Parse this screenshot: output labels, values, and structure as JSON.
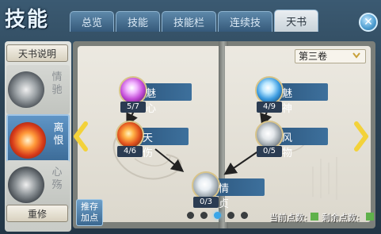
{
  "title": "技能",
  "tabs": [
    {
      "label": "总览"
    },
    {
      "label": "技能"
    },
    {
      "label": "技能栏"
    },
    {
      "label": "连续技"
    },
    {
      "label": "天书"
    }
  ],
  "active_tab": "天书",
  "left_panel": {
    "explain_button": "天书说明",
    "books": [
      {
        "label": "情驰",
        "state": "inactive"
      },
      {
        "label": "离恨",
        "state": "active"
      },
      {
        "label": "心殇",
        "state": "inactive"
      }
    ],
    "reset_button": "重修"
  },
  "recommend_button": "推存加点",
  "volume_selector": {
    "value": "第三卷"
  },
  "skills": [
    {
      "name": "魅心",
      "count": "5/7",
      "icon": "magic-heart-icon"
    },
    {
      "name": "天伤",
      "count": "4/6",
      "icon": "fire-wound-icon"
    },
    {
      "name": "情贞",
      "count": "0/3",
      "icon": "feather-icon"
    },
    {
      "name": "魅神",
      "count": "4/9",
      "icon": "water-spirit-icon"
    },
    {
      "name": "风物",
      "count": "0/5",
      "icon": "wind-icon"
    }
  ],
  "pagination": {
    "pages": 5,
    "current": 3
  },
  "footer": {
    "current_points_label": "当前点数:",
    "remaining_points_label": "剩余点数:"
  },
  "colors": {
    "tab_active": "#e9eef1",
    "accent_blue": "#3d709c",
    "page_bg": "#ece9e1",
    "arrow_yellow": "#f3d23a"
  }
}
